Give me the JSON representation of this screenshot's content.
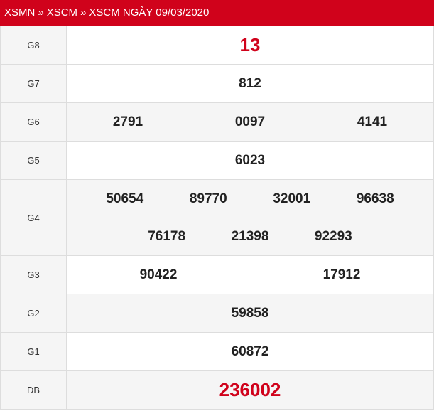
{
  "header": {
    "crumbs": [
      "XSMN",
      "XSCM"
    ],
    "separator": "»",
    "title": "XSCM NGÀY 09/03/2020"
  },
  "colors": {
    "brand_red": "#d0021b",
    "label_bg": "#f5f5f5",
    "border": "#dddddd"
  },
  "prizes": [
    {
      "label": "G8",
      "numbers": [
        "13"
      ]
    },
    {
      "label": "G7",
      "numbers": [
        "812"
      ]
    },
    {
      "label": "G6",
      "numbers": [
        "2791",
        "0097",
        "4141"
      ]
    },
    {
      "label": "G5",
      "numbers": [
        "6023"
      ]
    },
    {
      "label": "G4",
      "numbers": [
        "50654",
        "89770",
        "32001",
        "96638",
        "76178",
        "21398",
        "92293"
      ]
    },
    {
      "label": "G3",
      "numbers": [
        "90422",
        "17912"
      ]
    },
    {
      "label": "G2",
      "numbers": [
        "59858"
      ]
    },
    {
      "label": "G1",
      "numbers": [
        "60872"
      ]
    },
    {
      "label": "ĐB",
      "numbers": [
        "236002"
      ]
    }
  ]
}
